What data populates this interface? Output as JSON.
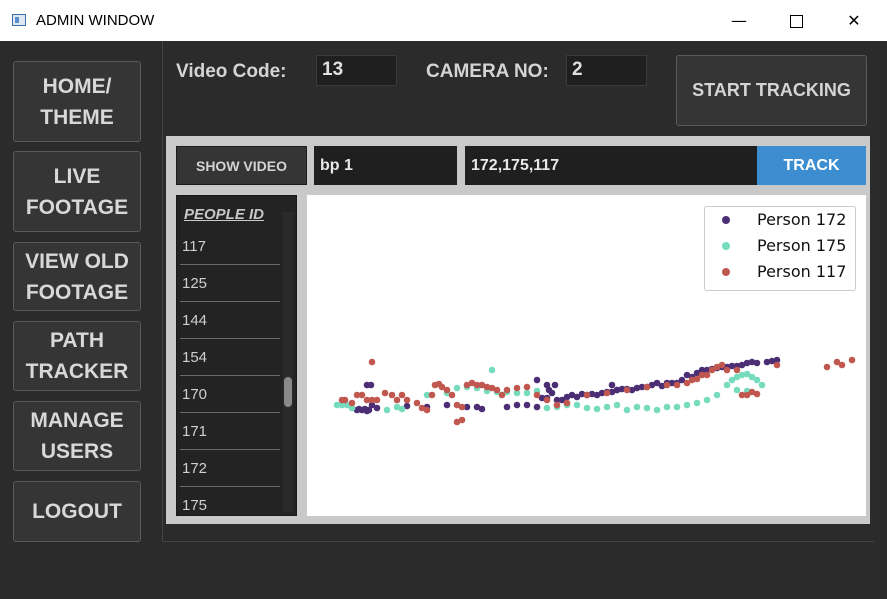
{
  "window": {
    "title": "ADMIN WINDOW",
    "minimize": "—",
    "close": "✕"
  },
  "nav": [
    {
      "label": "HOME/\nTHEME"
    },
    {
      "label": "LIVE\nFOOTAGE"
    },
    {
      "label": "VIEW OLD\nFOOTAGE"
    },
    {
      "label": "PATH\nTRACKER"
    },
    {
      "label": "MANAGE\nUSERS"
    },
    {
      "label": "LOGOUT"
    }
  ],
  "header": {
    "video_code_label": "Video Code:",
    "video_code_value": "13",
    "camera_label": "CAMERA NO:",
    "camera_value": "2",
    "start_tracking": "START TRACKING"
  },
  "toolbar": {
    "show_video": "SHOW VIDEO",
    "video_name": "bp 1",
    "people_ids": "172,175,117",
    "track": "TRACK"
  },
  "people": {
    "header": "PEOPLE ID",
    "ids": [
      "117",
      "125",
      "144",
      "154",
      "170",
      "171",
      "172",
      "175"
    ]
  },
  "chart_data": {
    "type": "scatter",
    "legend_position": "top-right",
    "grid": false,
    "series": [
      {
        "name": "Person 172",
        "color": "#4b2e73",
        "points": [
          [
            50,
            215
          ],
          [
            52,
            214
          ],
          [
            55,
            215
          ],
          [
            60,
            216
          ],
          [
            58,
            214
          ],
          [
            62,
            215
          ],
          [
            65,
            210
          ],
          [
            70,
            213
          ],
          [
            100,
            211
          ],
          [
            120,
            212
          ],
          [
            140,
            210
          ],
          [
            160,
            212
          ],
          [
            170,
            212
          ],
          [
            175,
            214
          ],
          [
            200,
            212
          ],
          [
            210,
            210
          ],
          [
            220,
            210
          ],
          [
            230,
            212
          ],
          [
            235,
            203
          ],
          [
            240,
            203
          ],
          [
            242,
            195
          ],
          [
            245,
            198
          ],
          [
            248,
            190
          ],
          [
            250,
            205
          ],
          [
            255,
            205
          ],
          [
            260,
            202
          ],
          [
            265,
            200
          ],
          [
            270,
            202
          ],
          [
            275,
            199
          ],
          [
            280,
            200
          ],
          [
            285,
            199
          ],
          [
            290,
            200
          ],
          [
            295,
            198
          ],
          [
            300,
            197
          ],
          [
            305,
            197
          ],
          [
            310,
            195
          ],
          [
            315,
            194
          ],
          [
            320,
            194
          ],
          [
            325,
            195
          ],
          [
            330,
            193
          ],
          [
            335,
            192
          ],
          [
            340,
            192
          ],
          [
            345,
            190
          ],
          [
            350,
            188
          ],
          [
            355,
            191
          ],
          [
            360,
            188
          ],
          [
            365,
            188
          ],
          [
            370,
            188
          ],
          [
            375,
            185
          ],
          [
            380,
            180
          ],
          [
            385,
            182
          ],
          [
            390,
            178
          ],
          [
            395,
            175
          ],
          [
            400,
            175
          ],
          [
            405,
            174
          ],
          [
            410,
            173
          ],
          [
            415,
            172
          ],
          [
            420,
            172
          ],
          [
            425,
            171
          ],
          [
            430,
            171
          ],
          [
            435,
            170
          ],
          [
            440,
            168
          ],
          [
            445,
            167
          ],
          [
            450,
            168
          ],
          [
            460,
            167
          ],
          [
            465,
            166
          ],
          [
            470,
            165
          ],
          [
            60,
            190
          ],
          [
            64,
            190
          ],
          [
            230,
            185
          ],
          [
            240,
            190
          ],
          [
            305,
            190
          ],
          [
            310,
            195
          ]
        ]
      },
      {
        "name": "Person 175",
        "color": "#76dcbd",
        "points": [
          [
            30,
            210
          ],
          [
            35,
            210
          ],
          [
            40,
            210
          ],
          [
            45,
            213
          ],
          [
            80,
            215
          ],
          [
            90,
            212
          ],
          [
            95,
            214
          ],
          [
            120,
            200
          ],
          [
            140,
            198
          ],
          [
            150,
            193
          ],
          [
            160,
            192
          ],
          [
            170,
            193
          ],
          [
            180,
            196
          ],
          [
            190,
            197
          ],
          [
            200,
            197
          ],
          [
            210,
            198
          ],
          [
            220,
            198
          ],
          [
            230,
            196
          ],
          [
            240,
            213
          ],
          [
            250,
            212
          ],
          [
            260,
            210
          ],
          [
            270,
            210
          ],
          [
            280,
            213
          ],
          [
            290,
            214
          ],
          [
            300,
            212
          ],
          [
            310,
            210
          ],
          [
            320,
            215
          ],
          [
            330,
            212
          ],
          [
            340,
            213
          ],
          [
            350,
            215
          ],
          [
            360,
            212
          ],
          [
            370,
            212
          ],
          [
            380,
            210
          ],
          [
            390,
            208
          ],
          [
            400,
            205
          ],
          [
            410,
            200
          ],
          [
            420,
            190
          ],
          [
            425,
            185
          ],
          [
            430,
            182
          ],
          [
            435,
            180
          ],
          [
            440,
            179
          ],
          [
            445,
            182
          ],
          [
            185,
            175
          ],
          [
            430,
            195
          ],
          [
            440,
            196
          ],
          [
            450,
            185
          ],
          [
            455,
            190
          ]
        ]
      },
      {
        "name": "Person 117",
        "color": "#c0584f",
        "points": [
          [
            35,
            205
          ],
          [
            38,
            205
          ],
          [
            45,
            208
          ],
          [
            50,
            200
          ],
          [
            55,
            200
          ],
          [
            60,
            205
          ],
          [
            65,
            205
          ],
          [
            70,
            205
          ],
          [
            65,
            167
          ],
          [
            78,
            198
          ],
          [
            85,
            200
          ],
          [
            90,
            205
          ],
          [
            95,
            200
          ],
          [
            100,
            205
          ],
          [
            110,
            208
          ],
          [
            115,
            213
          ],
          [
            120,
            215
          ],
          [
            125,
            200
          ],
          [
            128,
            190
          ],
          [
            132,
            189
          ],
          [
            135,
            192
          ],
          [
            140,
            195
          ],
          [
            145,
            200
          ],
          [
            150,
            210
          ],
          [
            155,
            212
          ],
          [
            160,
            190
          ],
          [
            165,
            188
          ],
          [
            170,
            190
          ],
          [
            175,
            190
          ],
          [
            180,
            192
          ],
          [
            185,
            193
          ],
          [
            190,
            195
          ],
          [
            195,
            200
          ],
          [
            200,
            195
          ],
          [
            210,
            193
          ],
          [
            220,
            192
          ],
          [
            230,
            200
          ],
          [
            240,
            205
          ],
          [
            250,
            210
          ],
          [
            260,
            208
          ],
          [
            280,
            200
          ],
          [
            300,
            198
          ],
          [
            320,
            195
          ],
          [
            340,
            192
          ],
          [
            360,
            190
          ],
          [
            370,
            190
          ],
          [
            380,
            188
          ],
          [
            385,
            185
          ],
          [
            390,
            184
          ],
          [
            395,
            180
          ],
          [
            400,
            180
          ],
          [
            405,
            175
          ],
          [
            410,
            172
          ],
          [
            415,
            170
          ],
          [
            420,
            175
          ],
          [
            430,
            175
          ],
          [
            435,
            200
          ],
          [
            440,
            200
          ],
          [
            445,
            197
          ],
          [
            450,
            199
          ],
          [
            155,
            225
          ],
          [
            150,
            227
          ],
          [
            470,
            170
          ],
          [
            520,
            172
          ],
          [
            530,
            167
          ],
          [
            535,
            170
          ],
          [
            545,
            165
          ]
        ]
      }
    ]
  }
}
